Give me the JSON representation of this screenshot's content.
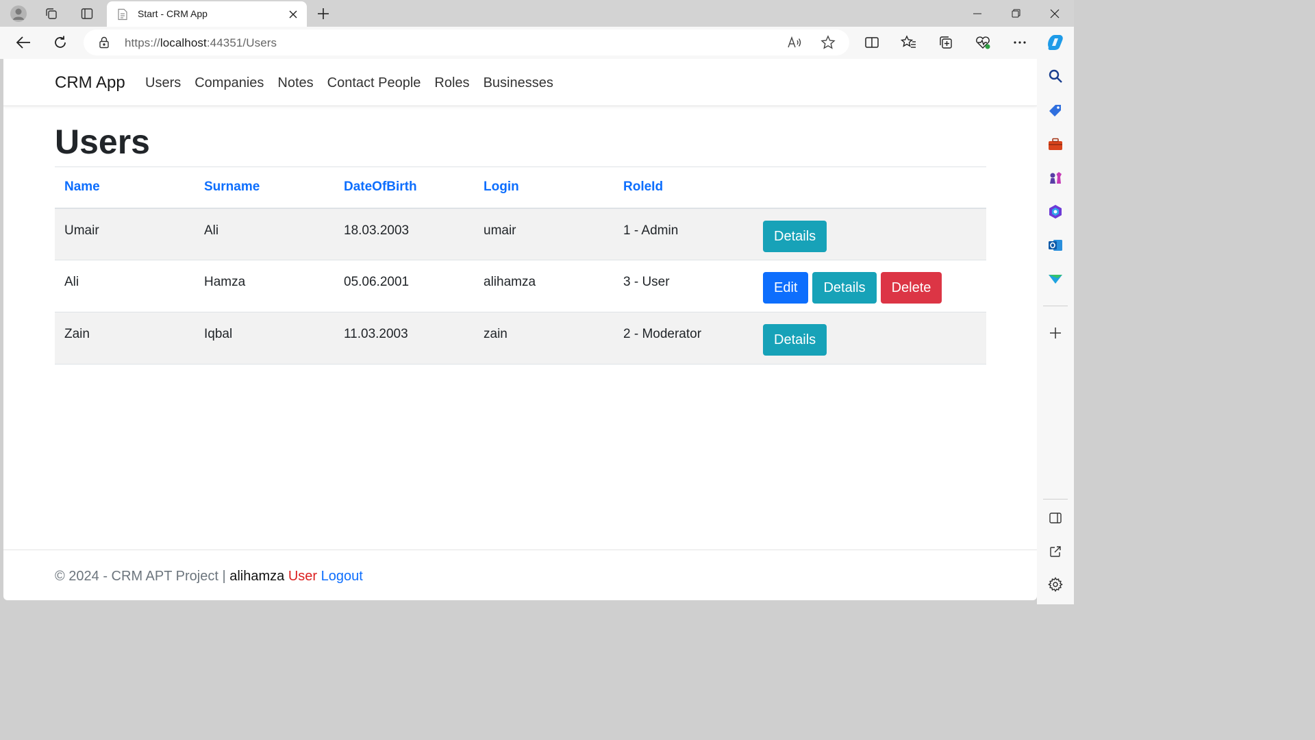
{
  "browser": {
    "tab_title": "Start - CRM App",
    "url_prefix": "https://",
    "url_host": "localhost",
    "url_rest": ":44351/Users"
  },
  "nav": {
    "brand": "CRM App",
    "links": [
      "Users",
      "Companies",
      "Notes",
      "Contact People",
      "Roles",
      "Businesses"
    ]
  },
  "page": {
    "title": "Users",
    "table": {
      "headers": [
        "Name",
        "Surname",
        "DateOfBirth",
        "Login",
        "RoleId"
      ],
      "rows": [
        {
          "name": "Umair",
          "surname": "Ali",
          "dob": "18.03.2003",
          "login": "umair",
          "role": "1 - Admin"
        },
        {
          "name": "Ali",
          "surname": "Hamza",
          "dob": "05.06.2001",
          "login": "alihamza",
          "role": "3 - User"
        },
        {
          "name": "Zain",
          "surname": "Iqbal",
          "dob": "11.03.2003",
          "login": "zain",
          "role": "2 - Moderator"
        }
      ]
    },
    "buttons": {
      "edit": "Edit",
      "details": "Details",
      "delete": "Delete"
    }
  },
  "footer": {
    "copyright": "© 2024 - CRM APT Project |",
    "username": "alihamza",
    "role": "User",
    "logout": "Logout"
  },
  "colors": {
    "link": "#0d6efd",
    "details": "#17a2b8",
    "delete": "#dc3545",
    "role": "#dc1f1f"
  }
}
